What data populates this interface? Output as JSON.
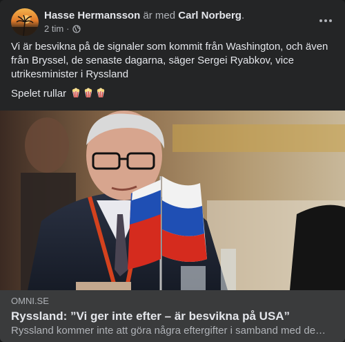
{
  "post": {
    "author": "Hasse Hermansson",
    "connector": " är med ",
    "tagged": "Carl Norberg",
    "tagged_suffix": ".",
    "time": "2 tim",
    "time_separator": "·",
    "privacy_icon": "globe-icon",
    "text_p1": "Vi är besvikna på de signaler som kommit från Washington, och även från Bryssel, de senaste dagarna, säger Sergei Ryabkov, vice utrikesminister i Ryssland",
    "text_p2": "Spelet rullar",
    "emojis": [
      "popcorn-icon",
      "popcorn-icon",
      "popcorn-icon"
    ]
  },
  "link": {
    "domain": "OMNI.SE",
    "title": "Ryssland: ”Vi ger inte efter – är besvikna på USA”",
    "description": "Ryssland kommer inte att göra några eftergifter i samband med de…"
  },
  "colors": {
    "card": "#242526",
    "link_box": "#3a3b3c",
    "text_primary": "#e4e6eb",
    "text_secondary": "#b0b3b8"
  }
}
